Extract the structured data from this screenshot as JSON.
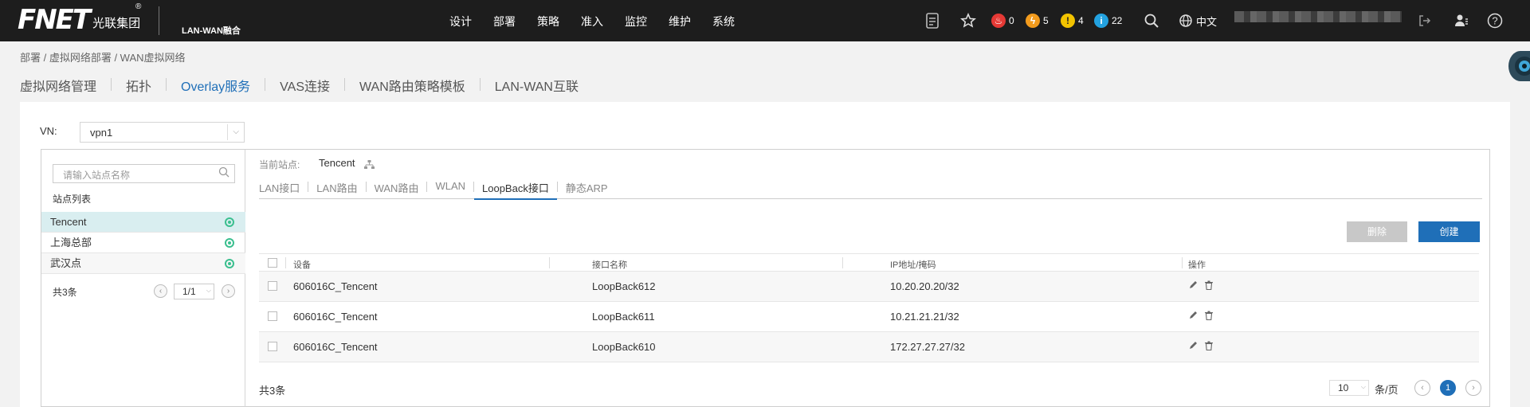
{
  "topbar": {
    "logo_text": "FNET",
    "logo_cn": "光联集团",
    "logo_sub": "LAN-WAN融合",
    "nav": [
      "设计",
      "部署",
      "策略",
      "准入",
      "监控",
      "维护",
      "系统"
    ],
    "alerts": [
      {
        "icon": "fire-alert-icon",
        "count": "0",
        "color": "#e53935"
      },
      {
        "icon": "bolt-alert-icon",
        "count": "5",
        "color": "#f29b1d"
      },
      {
        "icon": "warning-alert-icon",
        "count": "4",
        "color": "#f2c300"
      },
      {
        "icon": "info-alert-icon",
        "count": "22",
        "color": "#23a2e0"
      }
    ],
    "language": "中文"
  },
  "breadcrumb": "部署 / 虚拟网络部署 / WAN虚拟网络",
  "page_tabs": [
    "虚拟网络管理",
    "拓扑",
    "Overlay服务",
    "VAS连接",
    "WAN路由策略模板",
    "LAN-WAN互联"
  ],
  "active_page_tab": "Overlay服务",
  "vn": {
    "label": "VN:",
    "value": "vpn1"
  },
  "site_panel": {
    "search_placeholder": "请输入站点名称",
    "list_title": "站点列表",
    "sites": [
      "Tencent",
      "上海总部",
      "武汉点"
    ],
    "total": "共3条",
    "page": "1/1"
  },
  "current_site": {
    "label": "当前站点:",
    "value": "Tencent"
  },
  "inner_tabs": [
    "LAN接口",
    "LAN路由",
    "WAN路由",
    "WLAN",
    "LoopBack接口",
    "静态ARP"
  ],
  "active_inner_tab": "LoopBack接口",
  "buttons": {
    "delete": "删除",
    "create": "创建"
  },
  "table": {
    "headers": [
      "设备",
      "接口名称",
      "IP地址/掩码",
      "操作"
    ],
    "rows": [
      [
        "606016C_Tencent",
        "LoopBack612",
        "10.20.20.20/32"
      ],
      [
        "606016C_Tencent",
        "LoopBack611",
        "10.21.21.21/32"
      ],
      [
        "606016C_Tencent",
        "LoopBack610",
        "172.27.27.27/32"
      ]
    ]
  },
  "footer": {
    "total": "共3条",
    "page_size": "10",
    "page_size_label": "条/页",
    "current_page": "1"
  },
  "colors": {
    "accent": "#1f6fb8",
    "topbar": "#1d1d1d",
    "online": "#3bbf8f"
  }
}
